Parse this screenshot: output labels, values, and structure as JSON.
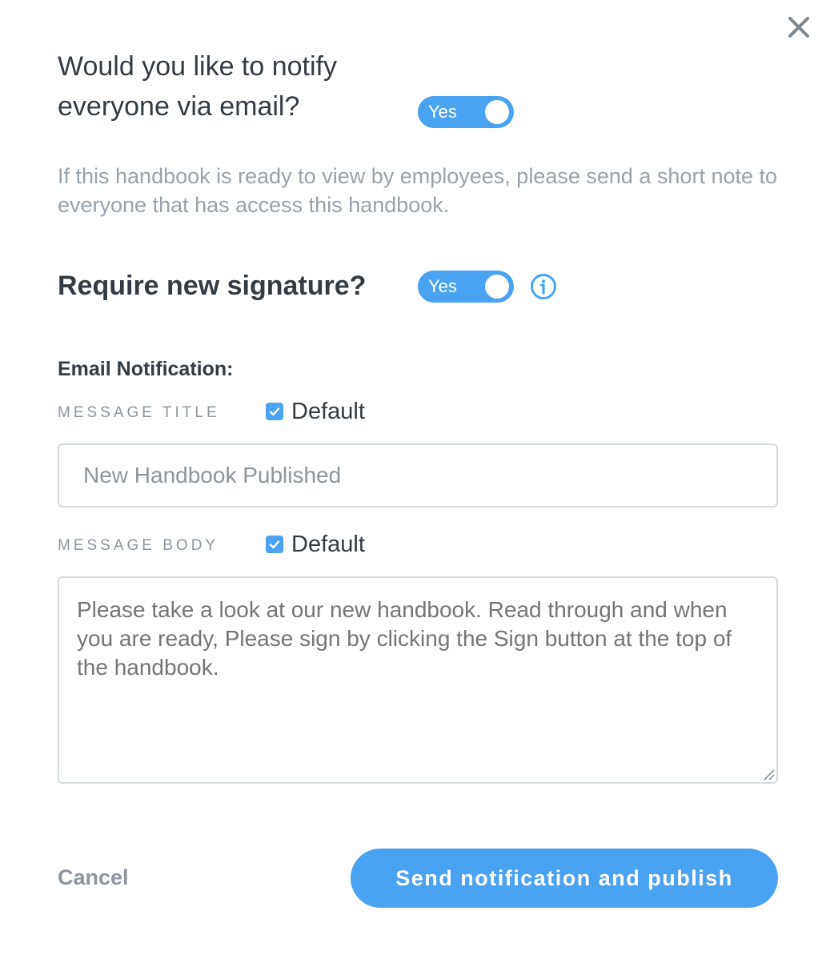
{
  "dialog": {
    "close_icon": "close-icon",
    "notify_question": "Would you like to notify everyone via email?",
    "notify_toggle": {
      "label": "Yes",
      "on": true
    },
    "description": "If this handbook is ready to view by employees, please send a short note to everyone that has access this handbook.",
    "signature_question": "Require new signature?",
    "signature_toggle": {
      "label": "Yes",
      "on": true
    },
    "info_icon": "info-icon",
    "email_section_heading": "Email Notification:",
    "message_title": {
      "label": "MESSAGE TITLE",
      "default_label": "Default",
      "default_checked": true,
      "placeholder": "New Handbook Published"
    },
    "message_body": {
      "label": "MESSAGE BODY",
      "default_label": "Default",
      "default_checked": true,
      "placeholder": "Please take a look at our new handbook. Read through and when you are ready, Please sign by clicking the Sign button at the top of the handbook."
    },
    "cancel_label": "Cancel",
    "submit_label": "Send notification and publish"
  },
  "colors": {
    "accent": "#4aa3f0",
    "text_dark": "#333b44",
    "text_muted": "#98a2ab",
    "border": "#d5dadf"
  }
}
